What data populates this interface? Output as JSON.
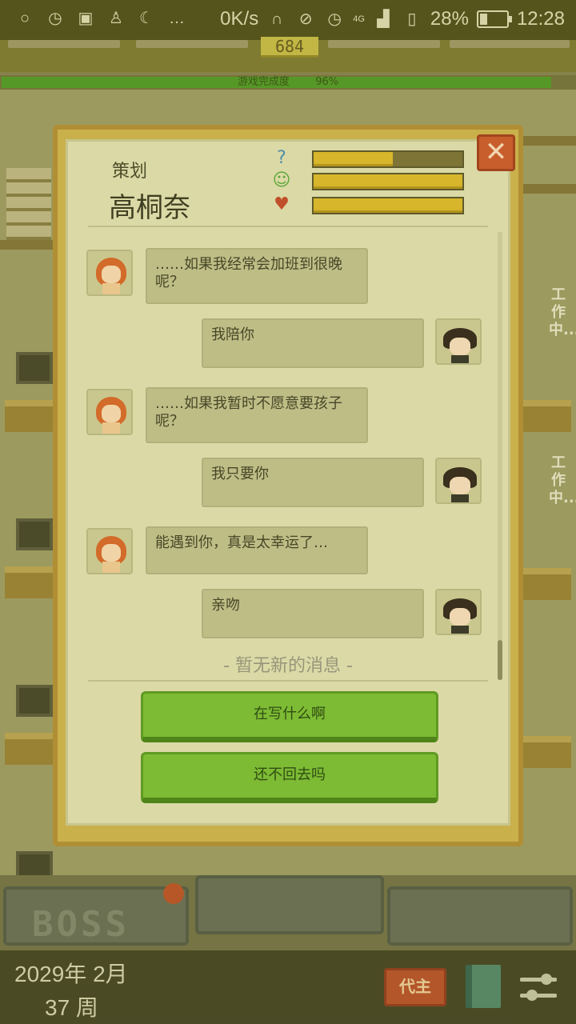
{
  "status_bar": {
    "speed": "0K/s",
    "network": "4G",
    "battery": "28%",
    "battery_level": 0.28,
    "time": "12:28"
  },
  "game_top": {
    "counter": "684",
    "progress_label": "游戏完成度",
    "progress_percent": "96%",
    "progress_value": 0.96
  },
  "office": {
    "working_label": "工作中..."
  },
  "dialog": {
    "role": "策划",
    "name": "高桐奈",
    "close_icon": "close-icon",
    "stats": [
      {
        "icon": "question-bubble-icon",
        "glyph": "?",
        "value": 0.53,
        "color": "#4f8fa8"
      },
      {
        "icon": "green-face-icon",
        "glyph": "☺",
        "value": 1.0,
        "color": "#5fa83a"
      },
      {
        "icon": "hearts-icon",
        "glyph": "♥",
        "value": 1.0,
        "color": "#c0502a"
      }
    ],
    "messages": [
      {
        "from": "npc",
        "text": "……如果我经常会加班到很晚呢？"
      },
      {
        "from": "player",
        "text": "我陪你"
      },
      {
        "from": "npc",
        "text": "……如果我暂时不愿意要孩子呢？"
      },
      {
        "from": "player",
        "text": "我只要你"
      },
      {
        "from": "npc",
        "text": "能遇到你，真是太幸运了…"
      },
      {
        "from": "player",
        "text": "亲吻"
      }
    ],
    "no_new_messages": "- 暂无新的消息 -",
    "choices": [
      "在写什么啊",
      "还不回去吗"
    ]
  },
  "bottom_bar": {
    "boss_label": "BOSS",
    "date_line1": "2029年 2月",
    "date_line2": "37 周",
    "outsource_label": "代主"
  }
}
